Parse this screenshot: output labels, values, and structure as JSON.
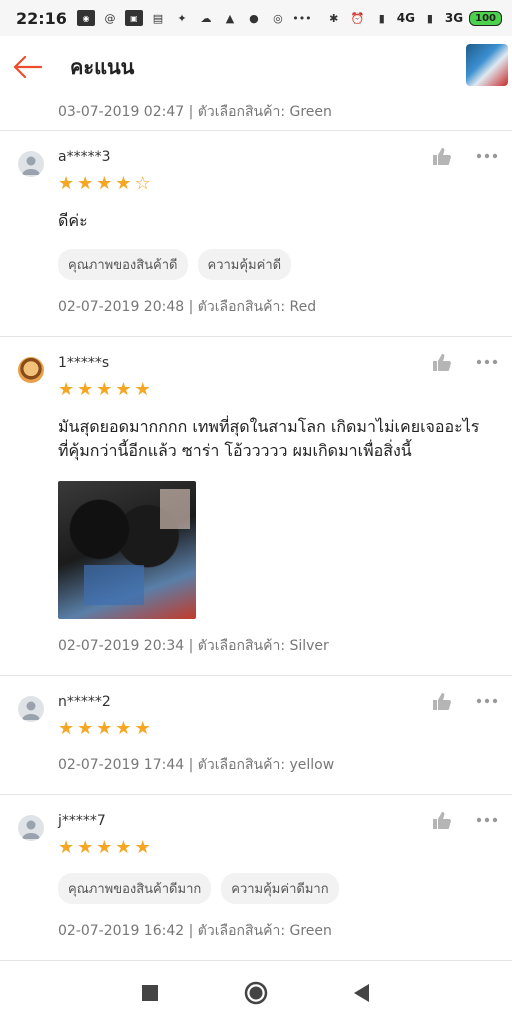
{
  "status_bar": {
    "time": "22:16",
    "left_icons": [
      "line-icon",
      "at-icon",
      "tmb-icon",
      "my-icon",
      "twitter-icon",
      "cloud-icon",
      "laz-icon",
      "chat-icon",
      "instagram-icon",
      "more-dots-icon"
    ],
    "net_1": "4G",
    "net_2": "3G",
    "battery": "100"
  },
  "header": {
    "title": "คะแนน"
  },
  "top_meta": "03-07-2019 02:47 | ตัวเลือกสินค้า: Green",
  "reviews": [
    {
      "username": "a*****3",
      "rating": 4,
      "comment": "ดีค่ะ",
      "tags": [
        "คุณภาพของสินค้าดี",
        "ความคุ้มค่าดี"
      ],
      "meta": "02-07-2019 20:48 | ตัวเลือกสินค้า: Red"
    },
    {
      "username": "1*****s",
      "rating": 5,
      "comment": "มันสุดยอดมากกกก เทพที่สุดในสามโลก เกิดมาไม่เคยเจออะไร ที่คุ้มกว่านี้อีกแล้ว ซาร่า โอ้ววววว ผมเกิดมาเพื่อสิ่งนี้",
      "meta": "02-07-2019 20:34 | ตัวเลือกสินค้า: Silver"
    },
    {
      "username": "n*****2",
      "rating": 5,
      "meta": "02-07-2019 17:44 | ตัวเลือกสินค้า: yellow"
    },
    {
      "username": "j*****7",
      "rating": 5,
      "tags": [
        "คุณภาพของสินค้าดีมาก",
        "ความคุ้มค่าดีมาก"
      ],
      "meta": "02-07-2019 16:42 | ตัวเลือกสินค้า: Green"
    }
  ],
  "colors": {
    "accent": "#ee4d2d",
    "star": "#f5a623",
    "muted_text": "#777777",
    "tag_bg": "#f2f2f2"
  }
}
